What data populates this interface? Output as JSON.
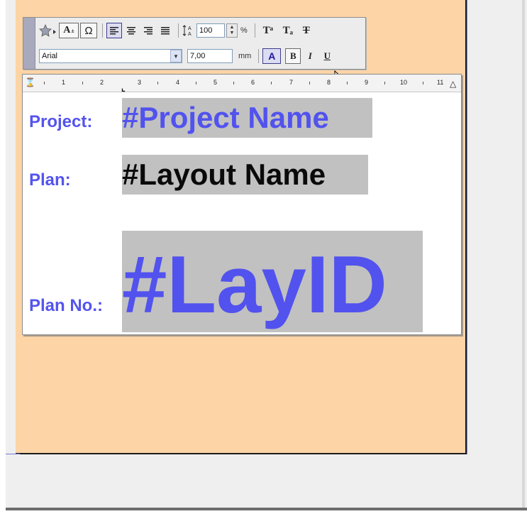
{
  "toolbar": {
    "row1": {
      "favorites_icon": "star-icon",
      "text_style_btn": "A",
      "special_char_btn": "Ω",
      "align_icons": [
        "align-left-icon",
        "align-center-icon",
        "align-right-icon",
        "align-justify-icon"
      ],
      "line_spacing_value": "100",
      "line_spacing_unit": "%",
      "superscript_label": "Tᵃ",
      "subscript_label": "Tₐ",
      "strikethrough_label": "T"
    },
    "row2": {
      "font_name": "Arial",
      "font_size": "7,00",
      "font_size_unit": "mm",
      "color_btn": "A",
      "bold_label": "B",
      "italic_label": "I",
      "underline_label": "U"
    }
  },
  "ruler": {
    "labels": [
      "1",
      "2",
      "3",
      "4",
      "5",
      "6",
      "7",
      "8",
      "9",
      "10",
      "11"
    ]
  },
  "frame": {
    "project_label": "Project:",
    "project_value": "#Project Name",
    "plan_label": "Plan:",
    "plan_value": "#Layout Name",
    "plan_no_label": "Plan No.:",
    "plan_no_value": "#LayID"
  },
  "colors": {
    "sheet_bg": "#fcd4a6",
    "label_blue": "#5454ee",
    "highlight_gray": "#c1c1c1"
  }
}
